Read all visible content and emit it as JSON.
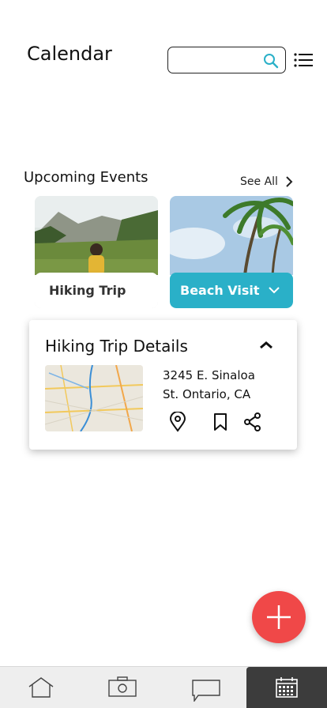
{
  "header": {
    "title": "Calendar",
    "search_value": "",
    "search_placeholder": ""
  },
  "upcoming": {
    "section_title": "Upcoming Events",
    "see_all_label": "See All",
    "events": [
      {
        "label": "Hiking Trip",
        "selected": false
      },
      {
        "label": "Beach Visit",
        "selected": true
      }
    ]
  },
  "details": {
    "title": "Hiking Trip Details",
    "address_line1": "3245 E. Sinaloa",
    "address_line2": "St. Ontario, CA",
    "actions": [
      "location-pin-icon",
      "bookmark-icon",
      "share-icon"
    ]
  },
  "tabs": [
    {
      "name": "home",
      "icon": "home-icon",
      "active": false
    },
    {
      "name": "camera",
      "icon": "camera-icon",
      "active": false
    },
    {
      "name": "messages",
      "icon": "chat-icon",
      "active": false
    },
    {
      "name": "calendar",
      "icon": "calendar-icon",
      "active": true
    }
  ],
  "colors": {
    "accent": "#2ab0c8",
    "fab": "#f04848",
    "active_tab": "#3c3c3c"
  }
}
